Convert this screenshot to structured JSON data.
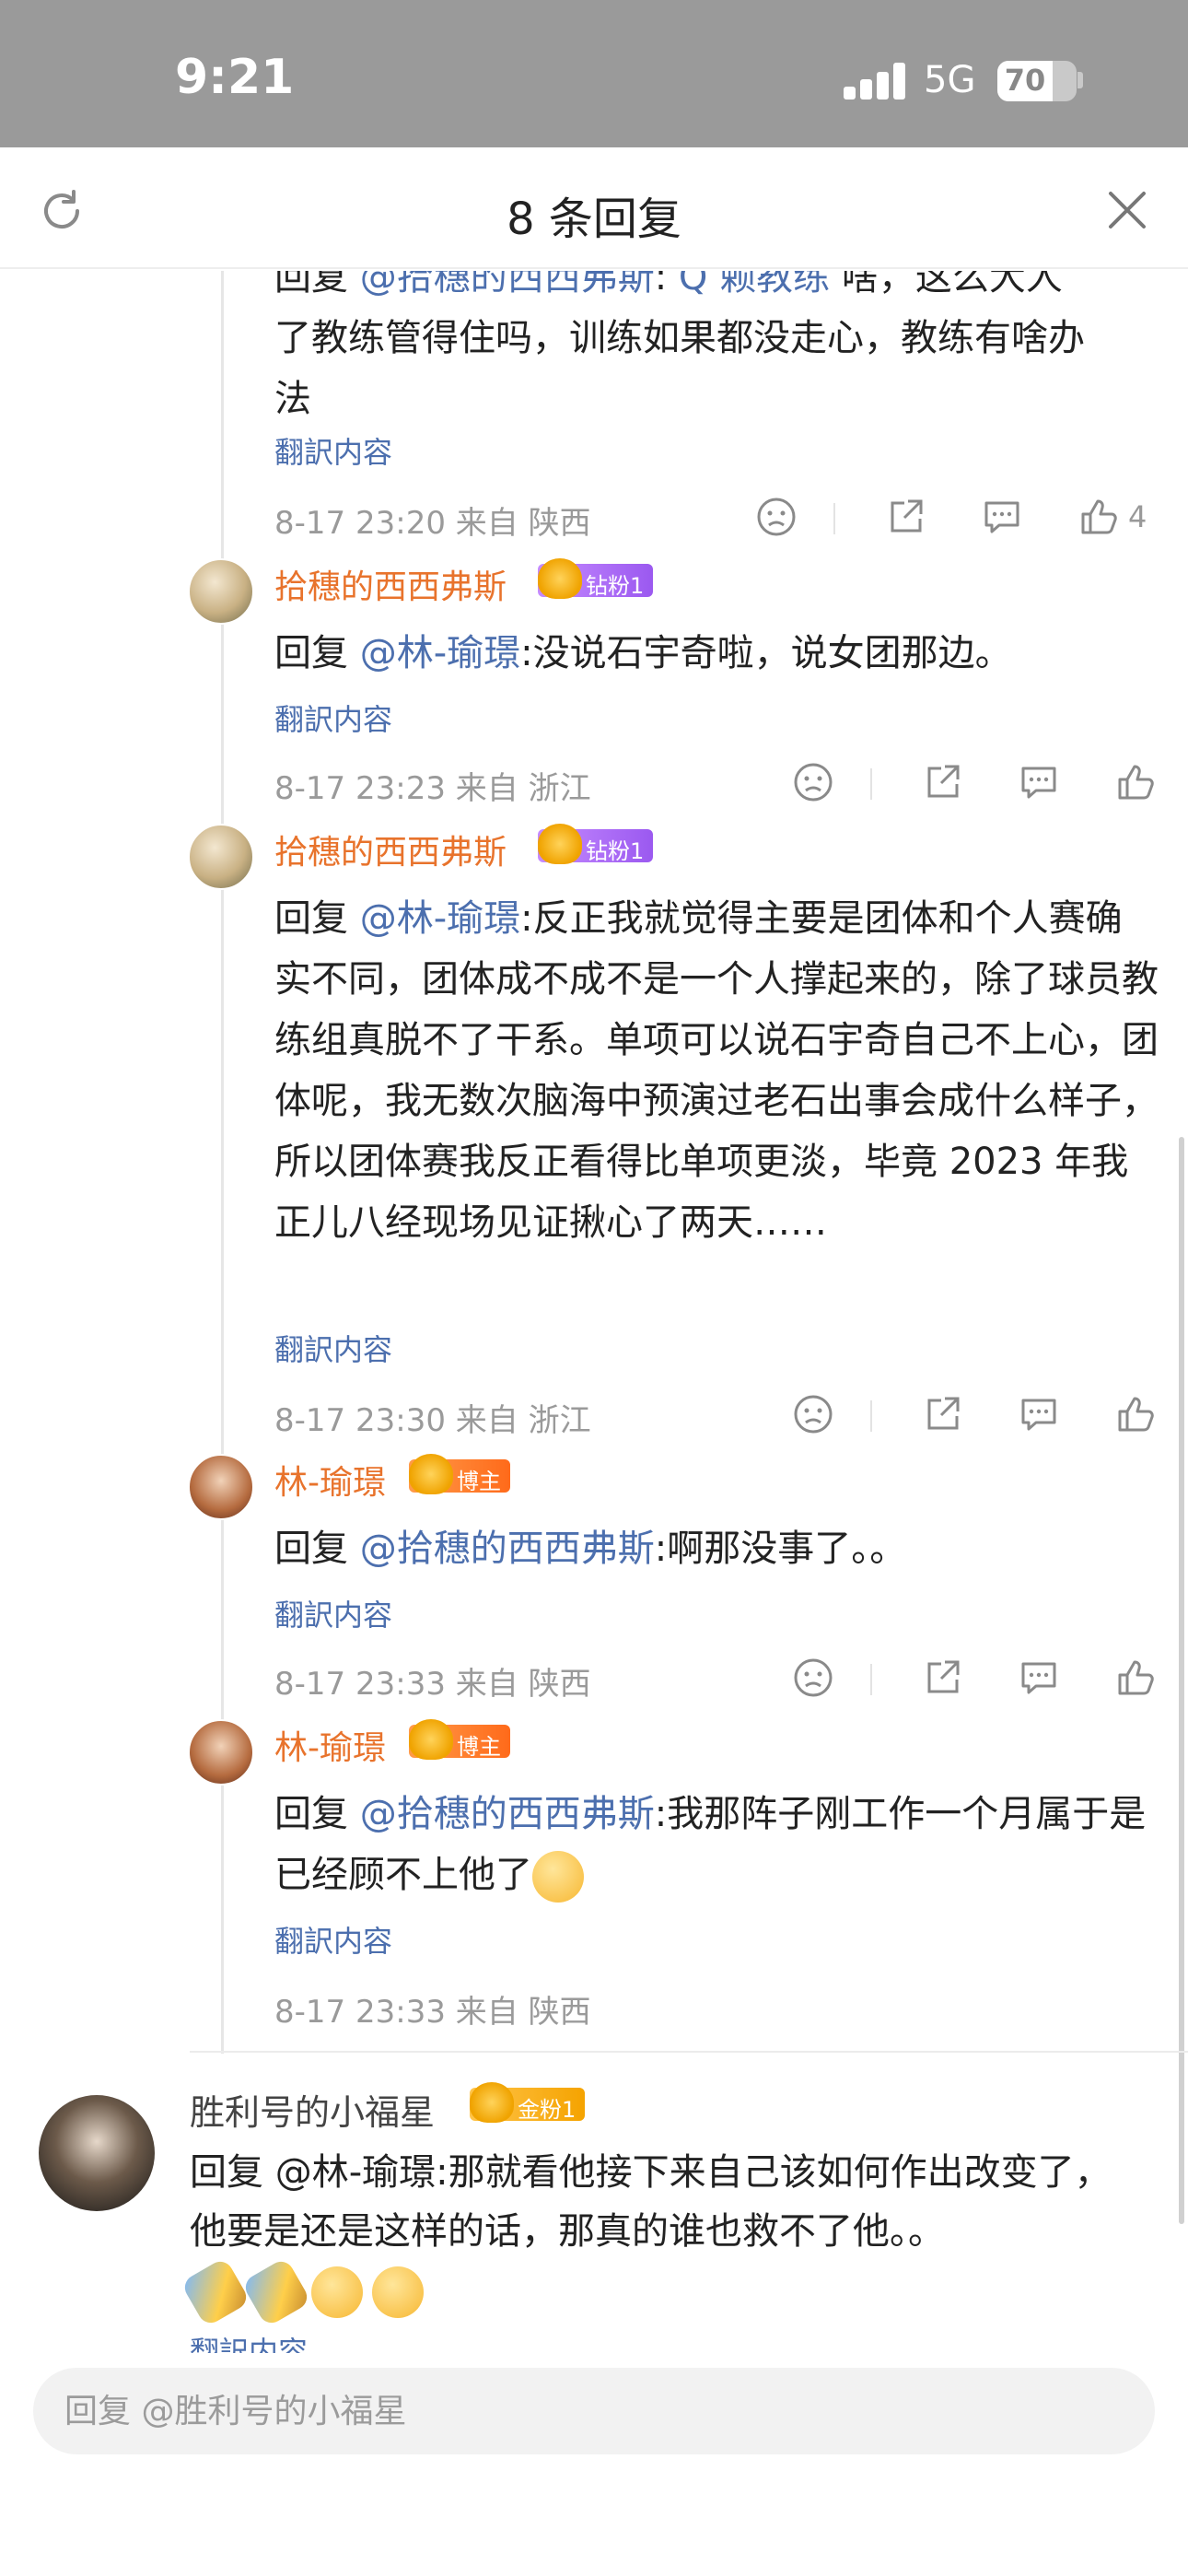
{
  "status_bar": {
    "time": "9:21",
    "network": "5G",
    "battery": "70"
  },
  "header": {
    "title": "8 条回复"
  },
  "partial_top": {
    "line1_prefix": "回复 ",
    "line1_at": "@拾穗的西西弗斯",
    "line1_rest": ": ",
    "line1_at2": "Q 赖教练",
    "line1_tail": " 啥，这么大人",
    "line2": "了教练管得住吗，训练如果都没走心，教练有啥办",
    "line3": "法",
    "translate": "翻訳内容",
    "meta": "8-17 23:20  来自 陕西",
    "like_count": "4"
  },
  "replies": [
    {
      "username": "拾穗的西西弗斯",
      "badge": "钻粉1",
      "prefix": "回复 ",
      "at": "@林-瑜璟",
      "body": ":没说石宇奇啦，说女团那边。",
      "translate": "翻訳内容",
      "meta": "8-17 23:23  来自 浙江"
    },
    {
      "username": "拾穗的西西弗斯",
      "badge": "钻粉1",
      "prefix": "回复 ",
      "at": "@林-瑜璟",
      "body": ":反正我就觉得主要是团体和个人赛确实不同，团体成不成不是一个人撑起来的，除了球员教练组真脱不了干系。单项可以说石宇奇自己不上心，团体呢，我无数次脑海中预演过老石出事会成什么样子，所以团体赛我反正看得比单项更淡，毕竟 2023 年我正儿八经现场见证揪心了两天……",
      "translate": "翻訳内容",
      "meta": "8-17 23:30  来自 浙江"
    },
    {
      "username": "林-瑜璟",
      "badge": "博主",
      "prefix": "回复 ",
      "at": "@拾穗的西西弗斯",
      "body": ":啊那没事了。。",
      "translate": "翻訳内容",
      "meta": "8-17 23:33  来自 陕西"
    },
    {
      "username": "林-瑜璟",
      "badge": "博主",
      "prefix": "回复 ",
      "at": "@拾穗的西西弗斯",
      "body": ":我那阵子刚工作一个月属于是已经顾不上他了",
      "translate": "翻訳内容",
      "meta": "8-17 23:33  来自 陕西"
    }
  ],
  "comment": {
    "username": "胜利号的小福星",
    "badge": "金粉1",
    "prefix": "回复 ",
    "at": "@林-瑜璟",
    "body": ":那就看他接下来自己该如何作出改变了，他要是还是这样的话，那真的谁也救不了他。。",
    "translate": "翻訳内容"
  },
  "input": {
    "placeholder": "回复 @胜利号的小福星"
  },
  "icons": {
    "refresh": "refresh-icon",
    "close": "close-icon",
    "sad": "sad-face-icon",
    "share": "share-icon",
    "comment": "comment-icon",
    "like": "thumbs-up-icon"
  }
}
